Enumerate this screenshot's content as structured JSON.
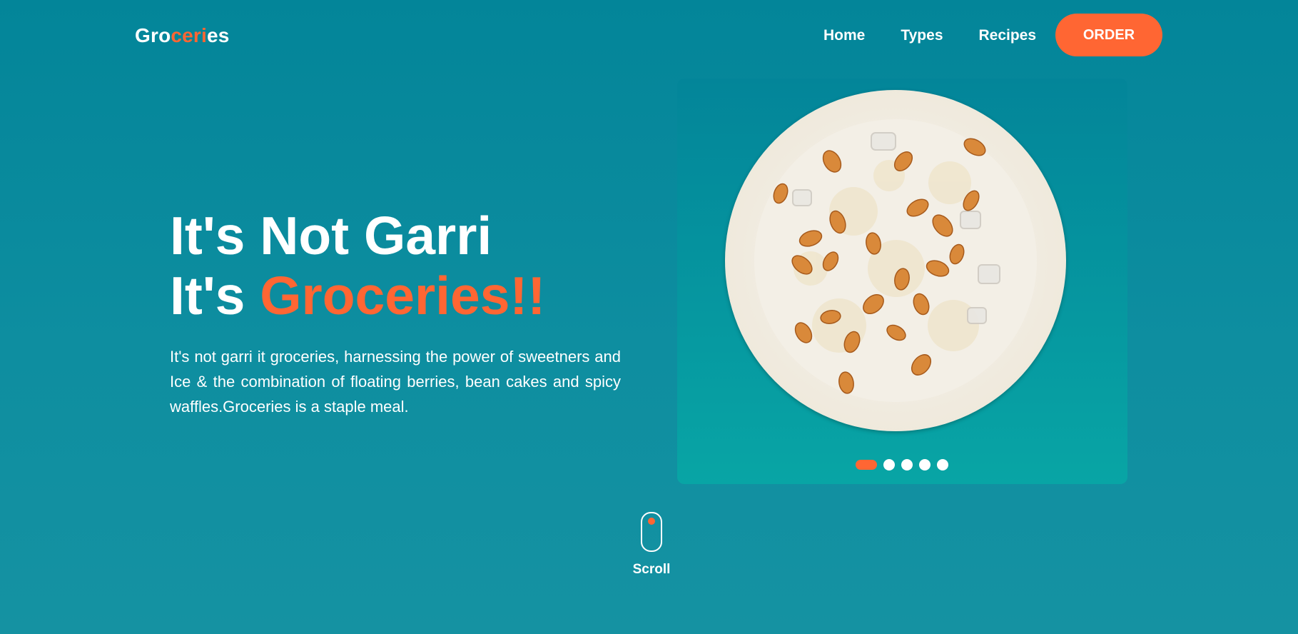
{
  "nav": {
    "logo": {
      "part1": "Gro",
      "part2": "ceri",
      "part3": "es"
    },
    "links": [
      "Home",
      "Types",
      "Recipes"
    ],
    "order_label": "ORDER"
  },
  "hero": {
    "line1": "It's Not Garri",
    "line2_prefix": "It's ",
    "line2_highlight": "Groceries!!",
    "description": "It's not garri it groceries, harnessing the power of sweetners and Ice & the combination of floating berries, bean cakes and spicy waffles.Groceries is a staple meal."
  },
  "carousel": {
    "image_icon": "bowl-of-groceries-image",
    "slide_count": 5,
    "active_index": 0
  },
  "scroll": {
    "label": "Scroll",
    "icon": "mouse-scroll-icon"
  },
  "colors": {
    "accent": "#ff6633",
    "background": "#038599",
    "text": "#ffffff"
  }
}
